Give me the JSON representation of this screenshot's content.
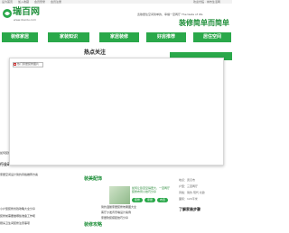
{
  "topbar": {
    "links": [
      "设为首页",
      "加入收藏",
      "会员登录",
      "会员注册",
      "网站导航",
      "联系我们"
    ],
    "right": "欢迎光临 · 城市生活网"
  },
  "header": {
    "logo_text": "瑞百网",
    "logo_url": "www.rbaidu.com",
    "slogan_sub": "宽敞居住空间简单的，幸福一室两厅 The taste of life",
    "slogan_main": "装修简单而简单"
  },
  "nav": {
    "items": [
      "装修家居",
      "家装知识",
      "家居装修",
      "好房推荐",
      "居住空间"
    ]
  },
  "main": {
    "title": "热点关注",
    "broken_image_alt": "热门家居装修图片"
  },
  "left_peek": [
    "如何装修一室一厅让居住空间更宽敞舒适",
    "居住空间小巧精致如何设计",
    "行业动态",
    "家居空间设计简约风格推荐方案",
    "小户型装修省钱攻略大全分享",
    "装修前需要做哪些准备工作呢",
    "厨房卫生间装修注意事项"
  ],
  "lane": {
    "title": "装美配饰",
    "tile_text": "如何让卧室显得更大，一室两厅装修布局小技巧分享",
    "pills": [
      "装修",
      "家居",
      "布置"
    ],
    "lines": [
      "简约温馨家居装修效果图大全",
      "客厅沙发背景墙设计案例",
      "家居软装搭配技巧分享"
    ],
    "bottom_title": "装修攻略"
  },
  "right_info": {
    "lines": [
      "地点：武汉市",
      "户型：三室两厅",
      "风格：简约 现代 北欧",
      "面积：120平米"
    ],
    "section_title": "了解家装步骤"
  },
  "colors": {
    "brand": "#2aa84a",
    "brand_dark": "#1f8f3a"
  }
}
